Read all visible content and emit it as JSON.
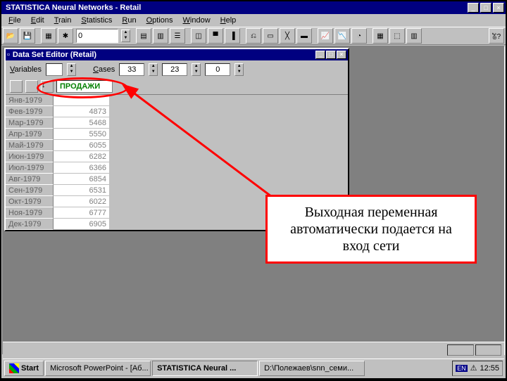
{
  "app_title": "STATISTICA Neural Networks - Retail",
  "menu": [
    "File",
    "Edit",
    "Train",
    "Statistics",
    "Run",
    "Options",
    "Window",
    "Help"
  ],
  "menu_u": [
    "F",
    "E",
    "T",
    "S",
    "R",
    "O",
    "W",
    "H"
  ],
  "toolbar_value": "0",
  "child_title": "Data Set Editor (Retail)",
  "var_label": "Variables",
  "cases_label": "Cases",
  "cases1": "33",
  "cases2": "23",
  "cases3": "0",
  "col_header": "ПРОДАЖИ",
  "rows": [
    {
      "h": "Янв-1979",
      "v": ""
    },
    {
      "h": "Фев-1979",
      "v": "4873"
    },
    {
      "h": "Мар-1979",
      "v": "5468"
    },
    {
      "h": "Апр-1979",
      "v": "5550"
    },
    {
      "h": "Май-1979",
      "v": "6055"
    },
    {
      "h": "Июн-1979",
      "v": "6282"
    },
    {
      "h": "Июл-1979",
      "v": "6366"
    },
    {
      "h": "Авг-1979",
      "v": "6854"
    },
    {
      "h": "Сен-1979",
      "v": "6531"
    },
    {
      "h": "Окт-1979",
      "v": "6022"
    },
    {
      "h": "Ноя-1979",
      "v": "6777"
    },
    {
      "h": "Дек-1979",
      "v": "6905"
    }
  ],
  "callout": "Выходная переменная автоматически подается на вход сети",
  "taskbar": {
    "start": "Start",
    "t1": "Microsoft PowerPoint - [Аб...",
    "t2": "STATISTICA Neural ...",
    "t3": "D:\\Полежаев\\snn_семи...",
    "lang": "EN",
    "clock": "12:55"
  }
}
